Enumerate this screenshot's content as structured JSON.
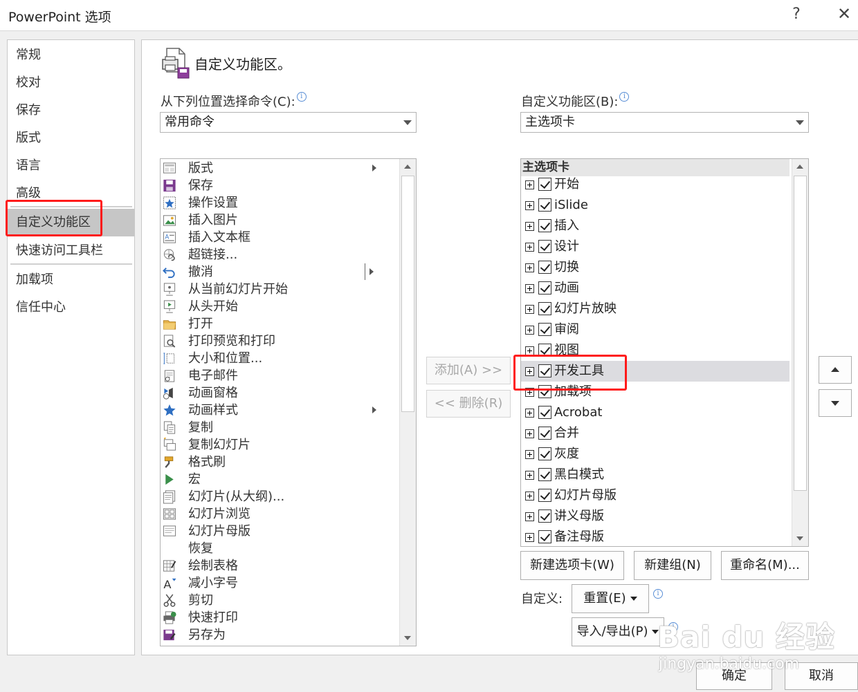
{
  "window": {
    "title": "PowerPoint 选项",
    "help": "?",
    "close": "✕"
  },
  "nav": {
    "items": [
      {
        "label": "常规"
      },
      {
        "label": "校对"
      },
      {
        "label": "保存"
      },
      {
        "label": "版式"
      },
      {
        "label": "语言"
      },
      {
        "label": "高级"
      },
      {
        "label": "自定义功能区"
      },
      {
        "label": "快速访问工具栏"
      },
      {
        "label": "加载项"
      },
      {
        "label": "信任中心"
      }
    ],
    "selected": "自定义功能区"
  },
  "header": {
    "title": "自定义功能区。",
    "icon": "customize-ribbon-icon"
  },
  "left": {
    "label": "从下列位置选择命令(C):",
    "select_value": "常用命令",
    "commands": [
      {
        "label": "版式",
        "icon": "layout-icon",
        "submenu": true
      },
      {
        "label": "保存",
        "icon": "save-icon"
      },
      {
        "label": "操作设置",
        "icon": "action-star-icon"
      },
      {
        "label": "插入图片",
        "icon": "insert-picture-icon"
      },
      {
        "label": "插入文本框",
        "icon": "text-box-icon"
      },
      {
        "label": "超链接...",
        "icon": "hyperlink-icon"
      },
      {
        "label": "撤消",
        "icon": "undo-icon",
        "split": true
      },
      {
        "label": "从当前幻灯片开始",
        "icon": "slideshow-current-icon"
      },
      {
        "label": "从头开始",
        "icon": "slideshow-start-icon"
      },
      {
        "label": "打开",
        "icon": "open-folder-icon"
      },
      {
        "label": "打印预览和打印",
        "icon": "print-preview-icon"
      },
      {
        "label": "大小和位置...",
        "icon": "size-position-icon"
      },
      {
        "label": "电子邮件",
        "icon": "email-icon"
      },
      {
        "label": "动画窗格",
        "icon": "animation-pane-icon"
      },
      {
        "label": "动画样式",
        "icon": "animation-style-icon",
        "submenu": true
      },
      {
        "label": "复制",
        "icon": "copy-icon"
      },
      {
        "label": "复制幻灯片",
        "icon": "duplicate-slide-icon"
      },
      {
        "label": "格式刷",
        "icon": "format-painter-icon"
      },
      {
        "label": "宏",
        "icon": "macro-icon"
      },
      {
        "label": "幻灯片(从大纲)...",
        "icon": "slides-from-outline-icon"
      },
      {
        "label": "幻灯片浏览",
        "icon": "slide-sorter-icon"
      },
      {
        "label": "幻灯片母版",
        "icon": "slide-master-icon"
      },
      {
        "label": "恢复",
        "icon": ""
      },
      {
        "label": "绘制表格",
        "icon": "draw-table-icon"
      },
      {
        "label": "减小字号",
        "icon": "decrease-font-icon"
      },
      {
        "label": "剪切",
        "icon": "cut-icon"
      },
      {
        "label": "快速打印",
        "icon": "quick-print-icon"
      },
      {
        "label": "另存为",
        "icon": "save-as-icon"
      }
    ]
  },
  "middle": {
    "add": "添加(A) >>",
    "remove": "<< 删除(R)"
  },
  "right": {
    "label": "自定义功能区(B):",
    "select_value": "主选项卡",
    "group_header": "主选项卡",
    "tabs": [
      {
        "label": "开始"
      },
      {
        "label": "iSlide"
      },
      {
        "label": "插入"
      },
      {
        "label": "设计"
      },
      {
        "label": "切换"
      },
      {
        "label": "动画"
      },
      {
        "label": "幻灯片放映"
      },
      {
        "label": "审阅"
      },
      {
        "label": "视图"
      },
      {
        "label": "开发工具"
      },
      {
        "label": "加载项"
      },
      {
        "label": "Acrobat"
      },
      {
        "label": "合并"
      },
      {
        "label": "灰度"
      },
      {
        "label": "黑白模式"
      },
      {
        "label": "幻灯片母版"
      },
      {
        "label": "讲义母版"
      },
      {
        "label": "备注母版"
      }
    ],
    "highlighted": "开发工具",
    "new_tab": "新建选项卡(W)",
    "new_group": "新建组(N)",
    "rename": "重命名(M)...",
    "customize_label": "自定义:",
    "reset": "重置(E)",
    "import_export": "导入/导出(P)"
  },
  "footer": {
    "ok": "确定",
    "cancel": "取消"
  },
  "watermark": {
    "brand": "Bai du 经验",
    "url": "jingyan.baidu.com"
  },
  "colors": {
    "highlight_box": "#ff1a1a",
    "nav_selected": "#c6c6c6",
    "row_highlight": "#dcdce0"
  }
}
